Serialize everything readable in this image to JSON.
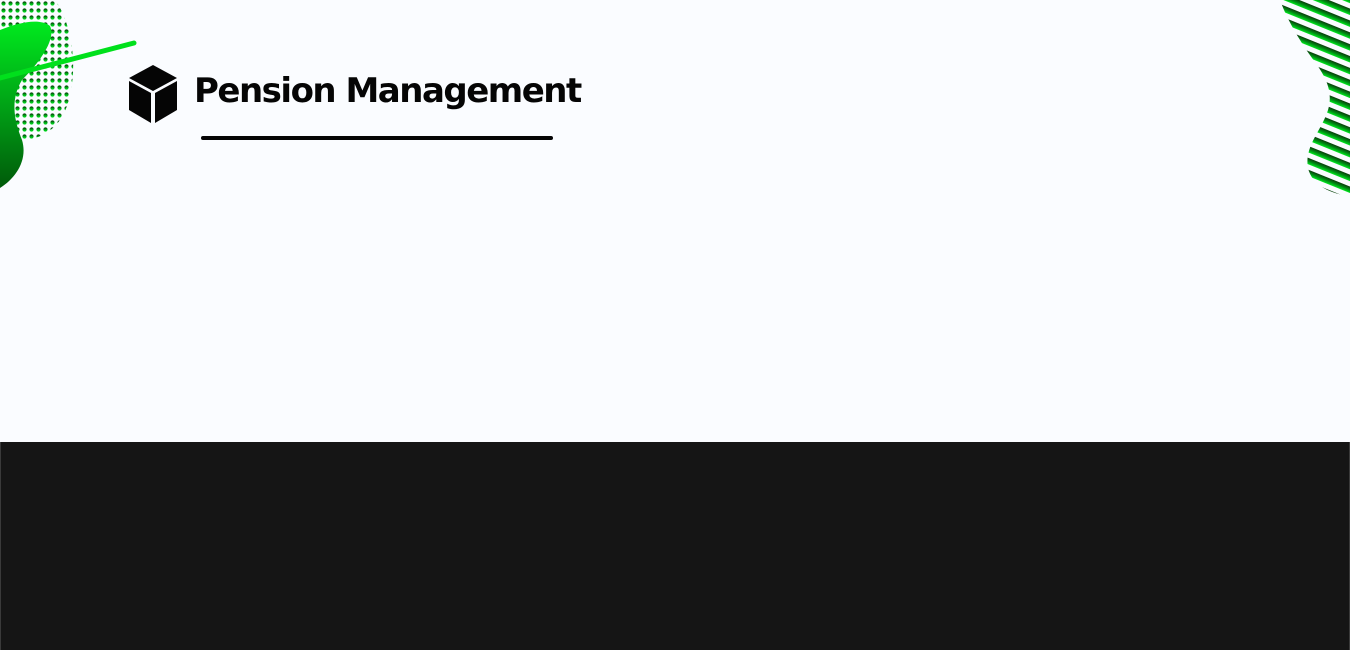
{
  "header": {
    "brand_name": "Pension Management",
    "logo_icon": "cube-icon"
  },
  "theme": {
    "background": "#fafcff",
    "dark_band": "#151515",
    "accent_light": "#00e01c",
    "accent_dark": "#005a0a",
    "text": "#050505"
  }
}
